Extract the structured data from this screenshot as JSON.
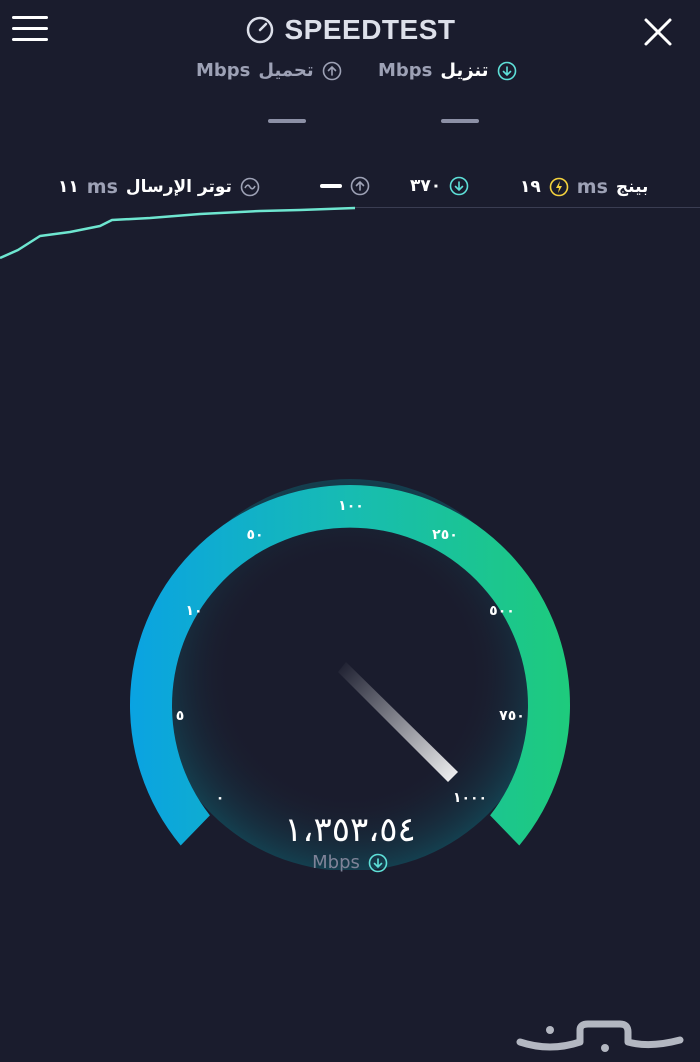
{
  "header": {
    "title": "SPEEDTEST",
    "menu_icon": "hamburger-menu-icon",
    "close_icon": "close-icon",
    "logo_icon": "speedometer-icon"
  },
  "tabs": {
    "download": {
      "label": "تنزيل",
      "unit": "Mbps",
      "icon": "download-arrow-icon",
      "value": "—"
    },
    "upload": {
      "label": "تحميل",
      "unit": "Mbps",
      "icon": "upload-arrow-icon",
      "value": "—"
    }
  },
  "stats": {
    "ping": {
      "label": "بينج",
      "unit": "ms",
      "value": "١٩",
      "icon": "ping-bolt-icon"
    },
    "download_latency": {
      "value": "٣٧٠",
      "icon": "download-arrow-icon"
    },
    "upload_latency": {
      "value": "—",
      "icon": "upload-arrow-icon"
    },
    "jitter": {
      "label": "توتر الإرسال",
      "unit": "ms",
      "value": "١١",
      "icon": "jitter-wave-icon"
    }
  },
  "gauge": {
    "labels": [
      "٠",
      "٥",
      "١٠",
      "٥٠",
      "١٠٠",
      "٢٥٠",
      "٥٠٠",
      "٧٥٠",
      "١٠٠٠"
    ],
    "reading": "١،٣٥٣،٥٤",
    "unit": "Mbps",
    "unit_icon": "download-arrow-icon",
    "colors": {
      "start": "#0aa3e2",
      "end": "#1ecb7c",
      "trail": "#6ee6d0"
    }
  },
  "watermark": {
    "text": "حراج"
  }
}
